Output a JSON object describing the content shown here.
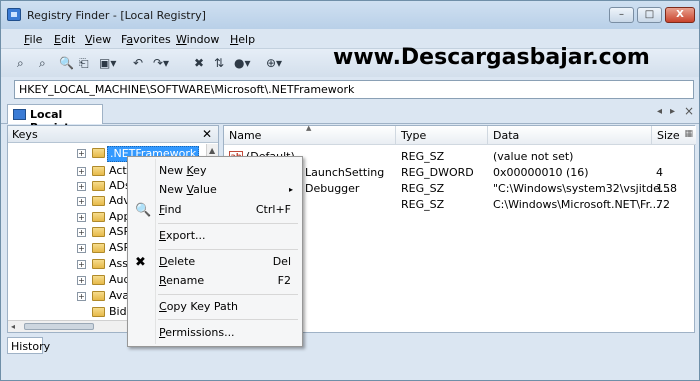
{
  "window": {
    "title": "Registry Finder - [Local Registry]",
    "controls": {
      "minimize": "–",
      "maximize": "□",
      "close": "X"
    }
  },
  "menu": [
    {
      "acc": "F",
      "rest": "ile"
    },
    {
      "acc": "E",
      "rest": "dit"
    },
    {
      "acc": "V",
      "rest": "iew"
    },
    {
      "pre": "F",
      "acc": "a",
      "rest": "vorites"
    },
    {
      "acc": "W",
      "rest": "indow"
    },
    {
      "acc": "H",
      "rest": "elp"
    }
  ],
  "toolbar": {
    "icons": [
      "find-icon",
      "find-next-icon",
      "zoom-icon",
      "favorites-icon",
      "save-icon",
      "undo-icon",
      "redo-icon",
      "delete-icon",
      "refresh-icon",
      "stop-icon",
      "go-icon"
    ]
  },
  "watermark": "www.Descargasbajar.com",
  "address": "HKEY_LOCAL_MACHINE\\SOFTWARE\\Microsoft\\.NETFramework",
  "doc_tab": "Local Registry",
  "tab_nav": {
    "left": "◂",
    "right": "▸",
    "close": "×"
  },
  "keys_pane": {
    "title": "Keys",
    "close": "✕",
    "tree": [
      {
        "label": ".NETFramework",
        "selected": true
      },
      {
        "label": "Acti"
      },
      {
        "label": "ADs"
      },
      {
        "label": "Adv"
      },
      {
        "label": "App"
      },
      {
        "label": "ASP"
      },
      {
        "label": "ASP"
      },
      {
        "label": "Assi"
      },
      {
        "label": "Aud"
      },
      {
        "label": "Ava"
      },
      {
        "label": "BidI"
      }
    ]
  },
  "values_pane": {
    "columns": {
      "name": "Name",
      "type": "Type",
      "data": "Data",
      "size": "Size"
    },
    "rows": [
      {
        "name": "(Default)",
        "type": "REG_SZ",
        "data": "(value not set)",
        "size": ""
      },
      {
        "name": "LaunchSetting",
        "type": "REG_DWORD",
        "data": "0x00000010 (16)",
        "size": "4"
      },
      {
        "name": "Debugger",
        "type": "REG_SZ",
        "data": "\"C:\\Windows\\system32\\vsjitde...",
        "size": "158"
      },
      {
        "name": "",
        "type": "REG_SZ",
        "data": "C:\\Windows\\Microsoft.NET\\Fr...",
        "size": "72"
      }
    ]
  },
  "history_label": "History",
  "context_menu": [
    {
      "pre": "New ",
      "acc": "K",
      "rest": "ey",
      "shortcut": ""
    },
    {
      "pre": "New ",
      "acc": "V",
      "rest": "alue",
      "shortcut": "",
      "submenu": "▸"
    },
    {
      "pre": "",
      "acc": "F",
      "rest": "ind",
      "shortcut": "Ctrl+F",
      "icon": "🔍"
    },
    {
      "pre": "",
      "acc": "E",
      "rest": "xport...",
      "shortcut": ""
    },
    {
      "pre": "",
      "acc": "D",
      "rest": "elete",
      "shortcut": "Del",
      "icon": "✖"
    },
    {
      "pre": "",
      "acc": "R",
      "rest": "ename",
      "shortcut": "F2"
    },
    {
      "pre": "",
      "acc": "C",
      "rest": "opy Key Path",
      "shortcut": ""
    },
    {
      "pre": "",
      "acc": "P",
      "rest": "ermissions...",
      "shortcut": ""
    }
  ]
}
